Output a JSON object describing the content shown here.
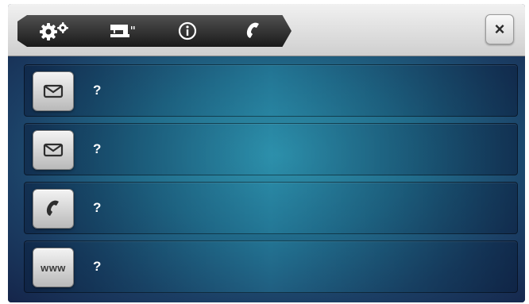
{
  "tabs": [
    {
      "icon": "settings-gears-icon"
    },
    {
      "icon": "machine-icon"
    },
    {
      "icon": "info-icon"
    },
    {
      "icon": "phone-icon"
    }
  ],
  "close": {
    "icon": "close-icon",
    "label": "×"
  },
  "rows": [
    {
      "icon": "envelope-icon",
      "value": "?"
    },
    {
      "icon": "envelope-icon",
      "value": "?"
    },
    {
      "icon": "phone-icon",
      "value": "?"
    },
    {
      "icon": "www-icon",
      "label": "www",
      "value": "?"
    }
  ]
}
